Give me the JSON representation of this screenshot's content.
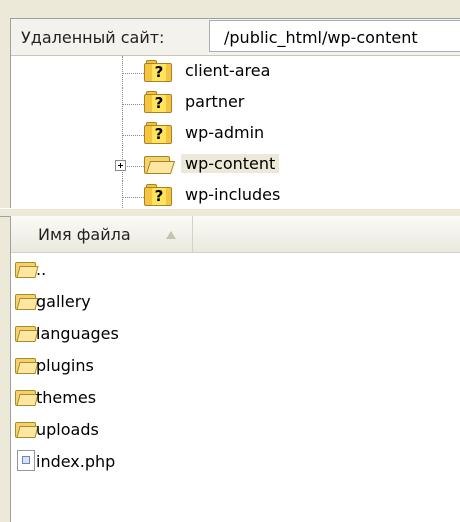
{
  "remote_site": {
    "label": "Удаленный сайт:",
    "path": "/public_html/wp-content"
  },
  "tree": {
    "items": [
      {
        "label": "client-area",
        "icon": "question-folder-icon"
      },
      {
        "label": "partner",
        "icon": "question-folder-icon"
      },
      {
        "label": "wp-admin",
        "icon": "question-folder-icon"
      },
      {
        "label": "wp-content",
        "icon": "open-folder-icon",
        "selected": true,
        "expandable": true
      },
      {
        "label": "wp-includes",
        "icon": "question-folder-icon"
      }
    ]
  },
  "file_list": {
    "column_name": "Имя файла",
    "sort_icon": "sort-ascending-icon",
    "items": [
      {
        "label": "..",
        "icon": "folder-icon"
      },
      {
        "label": "gallery",
        "icon": "folder-icon"
      },
      {
        "label": "languages",
        "icon": "folder-icon"
      },
      {
        "label": "plugins",
        "icon": "folder-icon"
      },
      {
        "label": "themes",
        "icon": "folder-icon"
      },
      {
        "label": "uploads",
        "icon": "folder-icon"
      },
      {
        "label": "index.php",
        "icon": "php-file-icon"
      }
    ]
  }
}
